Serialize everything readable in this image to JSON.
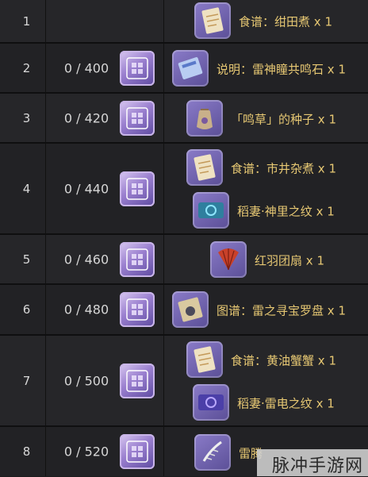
{
  "rows": [
    {
      "index": "1",
      "progress": "",
      "rewards": [
        {
          "icon": "recipe-icon",
          "label": "食谱：绀田煮",
          "qty": "x 1",
          "color": "#e8d4b0"
        }
      ]
    },
    {
      "index": "2",
      "progress": "0 / 400",
      "rewards": [
        {
          "icon": "manual-icon",
          "label": "说明：雷神瞳共鸣石",
          "qty": "x 1",
          "color": "#9fb8e6"
        }
      ]
    },
    {
      "index": "3",
      "progress": "0 / 420",
      "rewards": [
        {
          "icon": "seed-bag-icon",
          "label": "「鸣草」的种子",
          "qty": "x 1",
          "color": "#bfa7de"
        }
      ]
    },
    {
      "index": "4",
      "progress": "0 / 440",
      "rewards": [
        {
          "icon": "recipe-icon",
          "label": "食谱：市井杂煮",
          "qty": "x 1",
          "color": "#e8d4b0"
        },
        {
          "icon": "namecard-icon",
          "label": "稻妻·神里之纹",
          "qty": "x 1",
          "color": "#6fd0ea"
        }
      ]
    },
    {
      "index": "5",
      "progress": "0 / 460",
      "rewards": [
        {
          "icon": "red-fan-icon",
          "label": "红羽团扇",
          "qty": "x 1",
          "color": "#d14c2b"
        }
      ]
    },
    {
      "index": "6",
      "progress": "0 / 480",
      "rewards": [
        {
          "icon": "blueprint-icon",
          "label": "图谱：雷之寻宝罗盘",
          "qty": "x 1",
          "color": "#c9b690"
        }
      ]
    },
    {
      "index": "7",
      "progress": "0 / 500",
      "rewards": [
        {
          "icon": "recipe-icon",
          "label": "食谱：黄油蟹蟹",
          "qty": "x 1",
          "color": "#e8d4b0"
        },
        {
          "icon": "namecard-icon",
          "label": "稻妻·雷电之纹",
          "qty": "x 1",
          "color": "#8f82f0"
        }
      ]
    },
    {
      "index": "8",
      "progress": "0 / 520",
      "rewards": [
        {
          "icon": "feather-icon",
          "label": "雷腾",
          "qty": "",
          "color": "#d6cde6"
        }
      ]
    }
  ],
  "progress_icon": "primogem-wish-icon",
  "watermark": {
    "text": "脉冲手游网"
  }
}
